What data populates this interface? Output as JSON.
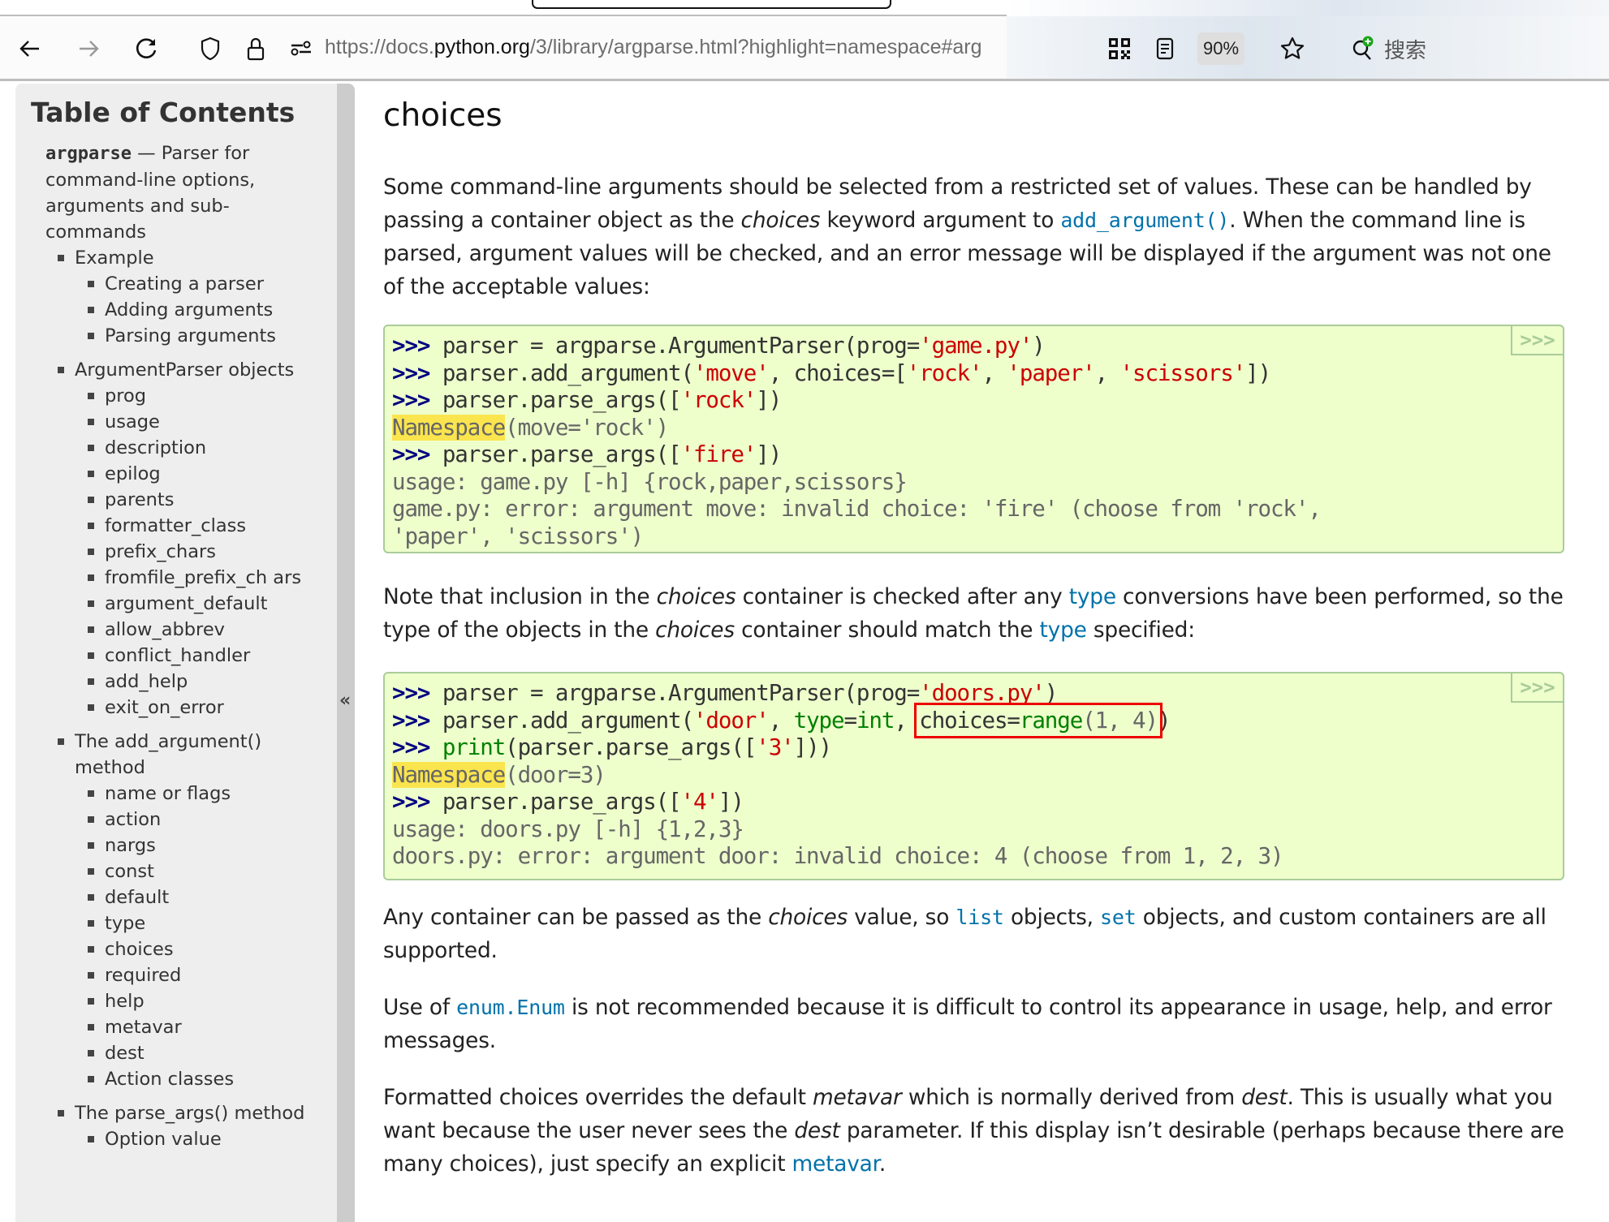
{
  "browser": {
    "url_prefix": "https://docs.",
    "url_host": "python.org",
    "url_rest": "/3/library/argparse.html?highlight=namespace#arg",
    "zoom_level": "90%",
    "search_label": "搜索",
    "icons": [
      "back-icon",
      "forward-icon",
      "reload-icon",
      "shield-icon",
      "lock-icon",
      "permissions-icon",
      "qr-code-icon",
      "reader-view-icon",
      "bookmark-star-icon",
      "search-plus-icon"
    ]
  },
  "sidebar": {
    "title": "Table of Contents",
    "lead_code": "argparse",
    "lead_text": " — Parser for command-line options, arguments and sub-commands",
    "collapse_label": "«",
    "items": [
      {
        "level": 1,
        "label": "Example"
      },
      {
        "level": 2,
        "label": "Creating a parser"
      },
      {
        "level": 2,
        "label": "Adding arguments"
      },
      {
        "level": 2,
        "label": "Parsing arguments"
      },
      {
        "level": 1,
        "label": "ArgumentParser objects"
      },
      {
        "level": 2,
        "label": "prog"
      },
      {
        "level": 2,
        "label": "usage"
      },
      {
        "level": 2,
        "label": "description"
      },
      {
        "level": 2,
        "label": "epilog"
      },
      {
        "level": 2,
        "label": "parents"
      },
      {
        "level": 2,
        "label": "formatter_class"
      },
      {
        "level": 2,
        "label": "prefix_chars"
      },
      {
        "level": 2,
        "label": "fromfile_prefix_ch ars"
      },
      {
        "level": 2,
        "label": "argument_default"
      },
      {
        "level": 2,
        "label": "allow_abbrev"
      },
      {
        "level": 2,
        "label": "conflict_handler"
      },
      {
        "level": 2,
        "label": "add_help"
      },
      {
        "level": 2,
        "label": "exit_on_error"
      },
      {
        "level": 1,
        "label": "The add_argument() method"
      },
      {
        "level": 2,
        "label": "name or flags"
      },
      {
        "level": 2,
        "label": "action"
      },
      {
        "level": 2,
        "label": "nargs"
      },
      {
        "level": 2,
        "label": "const"
      },
      {
        "level": 2,
        "label": "default"
      },
      {
        "level": 2,
        "label": "type"
      },
      {
        "level": 2,
        "label": "choices"
      },
      {
        "level": 2,
        "label": "required"
      },
      {
        "level": 2,
        "label": "help"
      },
      {
        "level": 2,
        "label": "metavar"
      },
      {
        "level": 2,
        "label": "dest"
      },
      {
        "level": 2,
        "label": "Action classes"
      },
      {
        "level": 1,
        "label": "The parse_args() method"
      },
      {
        "level": 2,
        "label": "Option value"
      }
    ]
  },
  "main": {
    "heading": "choices",
    "p1": {
      "a": "Some command-line arguments should be selected from a restricted set of values. These can be handled by passing a container object as the ",
      "em": "choices",
      "b": " keyword argument to ",
      "link": "add_argument()",
      "c": ". When the command line is parsed, argument values will be checked, and an error message will be displayed if the argument was not one of the acceptable values:"
    },
    "code1": {
      "copy_label": ">>>",
      "lines": [
        [
          [
            "gp",
            ">>> "
          ],
          [
            "",
            "parser = argparse.ArgumentParser(prog="
          ],
          [
            "s1",
            "'game.py'"
          ],
          [
            "",
            ")"
          ]
        ],
        [
          [
            "gp",
            ">>> "
          ],
          [
            "",
            "parser.add_argument("
          ],
          [
            "s1",
            "'move'"
          ],
          [
            "",
            ", choices=["
          ],
          [
            "s1",
            "'rock'"
          ],
          [
            "",
            ", "
          ],
          [
            "s1",
            "'paper'"
          ],
          [
            "",
            ", "
          ],
          [
            "s1",
            "'scissors'"
          ],
          [
            "",
            "])"
          ]
        ],
        [
          [
            "gp",
            ">>> "
          ],
          [
            "",
            "parser.parse_args(["
          ],
          [
            "s1",
            "'rock'"
          ],
          [
            "",
            "])"
          ]
        ],
        [
          [
            "go hl",
            "Namespace"
          ],
          [
            "go",
            "(move='rock')"
          ]
        ],
        [
          [
            "gp",
            ">>> "
          ],
          [
            "",
            "parser.parse_args(["
          ],
          [
            "s1",
            "'fire'"
          ],
          [
            "",
            "])"
          ]
        ],
        [
          [
            "go",
            "usage: game.py [-h] {rock,paper,scissors}"
          ]
        ],
        [
          [
            "go",
            "game.py: error: argument move: invalid choice: 'fire' (choose from 'rock',"
          ]
        ],
        [
          [
            "go",
            "'paper', 'scissors')"
          ]
        ]
      ]
    },
    "p2": {
      "a": "Note that inclusion in the ",
      "em1": "choices",
      "b": " container is checked after any ",
      "link1": "type",
      "c": " conversions have been performed, so the type of the objects in the ",
      "em2": "choices",
      "d": " container should match the ",
      "link2": "type",
      "e": " specified:"
    },
    "code2": {
      "copy_label": ">>>",
      "lines": [
        [
          [
            "gp",
            ">>> "
          ],
          [
            "",
            "parser = argparse.ArgumentParser(prog="
          ],
          [
            "s1",
            "'doors.py'"
          ],
          [
            "",
            ")"
          ]
        ],
        [
          [
            "gp",
            ">>> "
          ],
          [
            "",
            "parser.add_argument("
          ],
          [
            "s1",
            "'door'"
          ],
          [
            "",
            ", "
          ],
          [
            "nb",
            "type"
          ],
          [
            "",
            "="
          ],
          [
            "nb",
            "int"
          ],
          [
            "",
            ", "
          ],
          [
            "box",
            ""
          ],
          [
            "",
            ")"
          ]
        ],
        [
          [
            "gp",
            ">>> "
          ],
          [
            "nb",
            "print"
          ],
          [
            "",
            "(parser.parse_args(["
          ],
          [
            "s1",
            "'3'"
          ],
          [
            "",
            "]))"
          ]
        ],
        [
          [
            "go hl",
            "Namespace"
          ],
          [
            "go",
            "(door=3)"
          ]
        ],
        [
          [
            "gp",
            ">>> "
          ],
          [
            "",
            "parser.parse_args(["
          ],
          [
            "s1",
            "'4'"
          ],
          [
            "",
            "])"
          ]
        ],
        [
          [
            "go",
            "usage: doors.py [-h] {1,2,3}"
          ]
        ],
        [
          [
            "go",
            "doors.py: error: argument door: invalid choice: 4 (choose from 1, 2, 3)"
          ]
        ]
      ],
      "boxed": [
        [
          "",
          "choices="
        ],
        [
          "nb",
          "range"
        ],
        [
          "go",
          "(1, 4)"
        ]
      ]
    },
    "p3": {
      "a": "Any container can be passed as the ",
      "em": "choices",
      "b": " value, so ",
      "link1": "list",
      "c": " objects, ",
      "link2": "set",
      "d": " objects, and custom containers are all supported."
    },
    "p4": {
      "a": "Use of ",
      "link": "enum.Enum",
      "b": " is not recommended because it is difficult to control its appearance in usage, help, and error messages."
    },
    "p5": {
      "a": "Formatted choices overrides the default ",
      "em1": "metavar",
      "b": " which is normally derived from ",
      "em2": "dest",
      "c": ". This is usually what you want because the user never sees the ",
      "em3": "dest",
      "d": " parameter. If this display isn’t desirable (perhaps because there are many choices), just specify an explicit ",
      "link": "metavar",
      "e": "."
    }
  }
}
